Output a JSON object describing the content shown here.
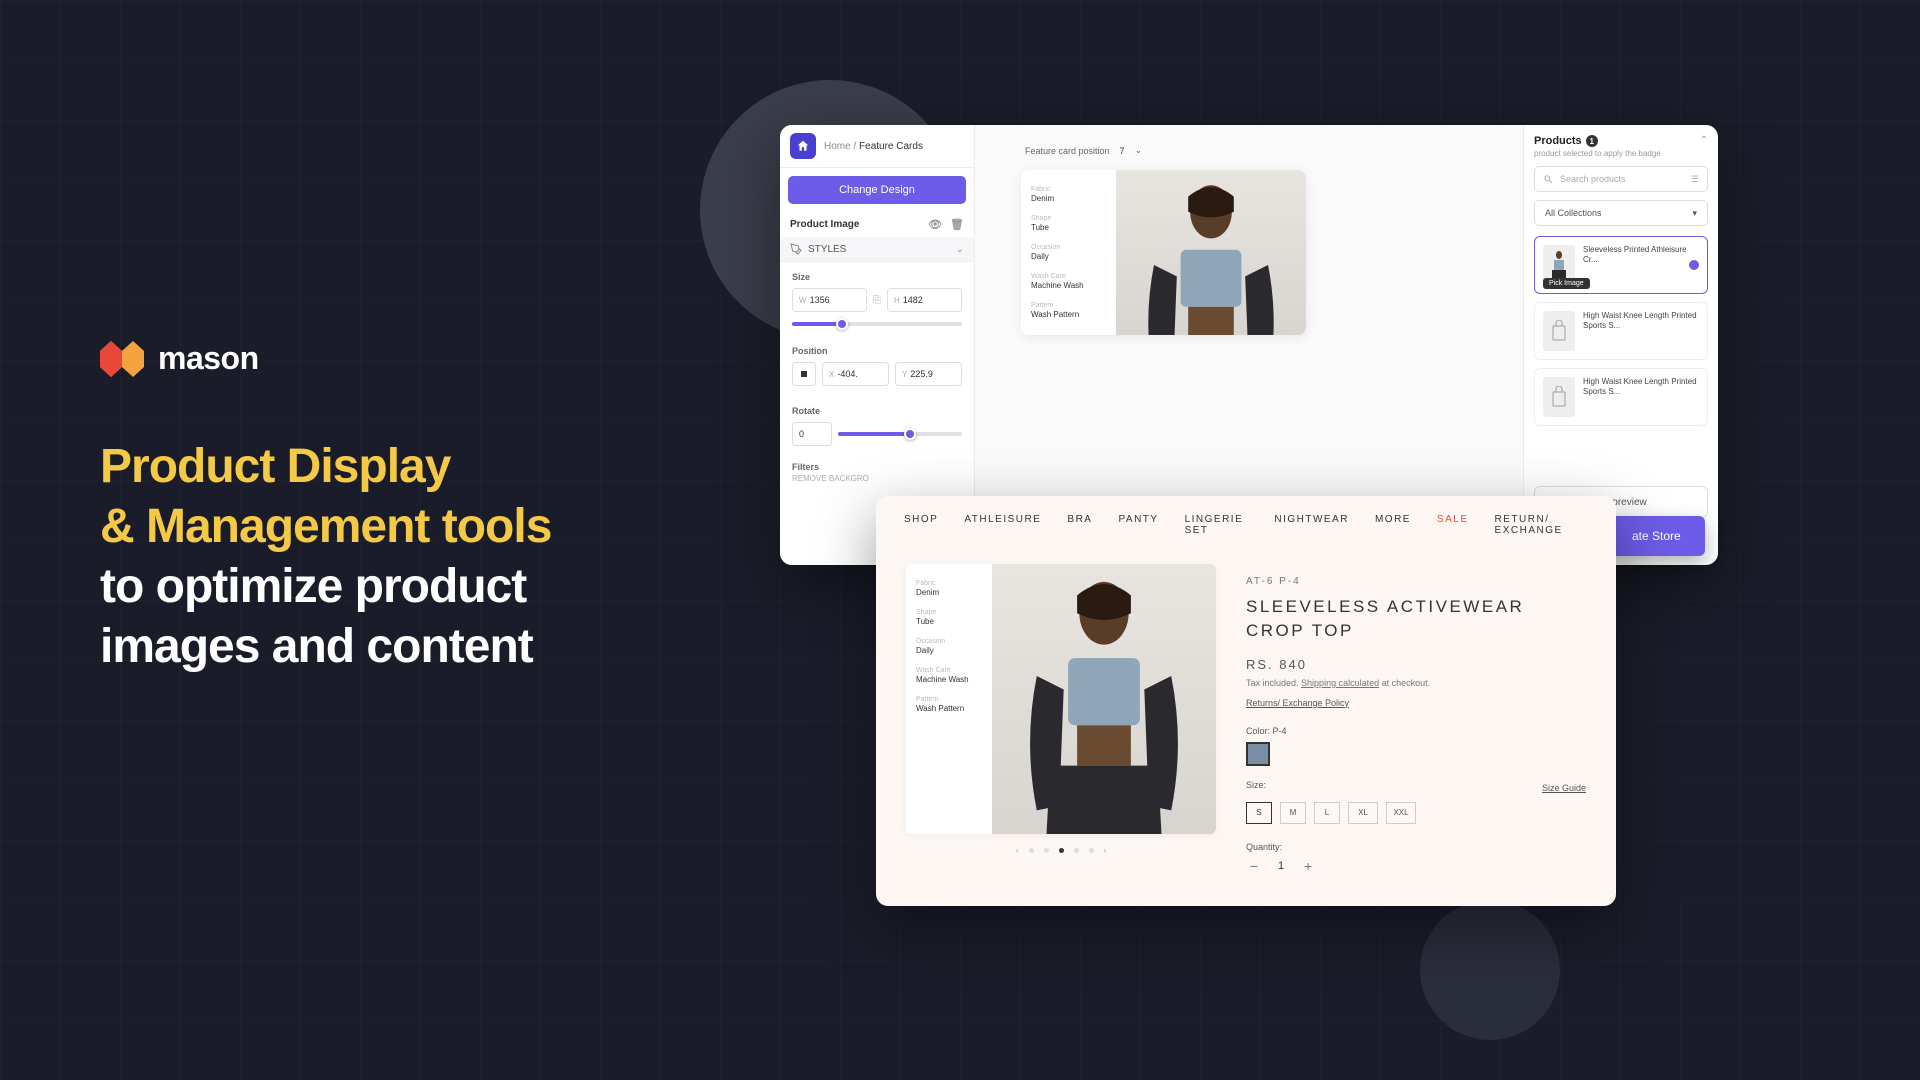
{
  "brand": {
    "name": "mason"
  },
  "headline": {
    "line1": "Product Display",
    "line2": "& Management tools",
    "line3": "to optimize product",
    "line4": "images and content"
  },
  "app1": {
    "breadcrumb": {
      "home": "Home",
      "sep": "/",
      "current": "Feature Cards"
    },
    "change_design": "Change Design",
    "section_title": "Product Image",
    "styles_label": "STYLES",
    "size": {
      "label": "Size",
      "w": "1356",
      "h": "1482"
    },
    "position": {
      "label": "Position",
      "x": "-404.",
      "y": "225.9"
    },
    "rotate": {
      "label": "Rotate",
      "val": "0"
    },
    "filters": {
      "label": "Filters",
      "sub": "REMOVE BACKGRO"
    },
    "canvas": {
      "fcp_label": "Feature card position",
      "fcp_val": "7"
    },
    "attrs": [
      {
        "label": "Fabric",
        "value": "Denim"
      },
      {
        "label": "Shape",
        "value": "Tube"
      },
      {
        "label": "Occasion",
        "value": "Daily"
      },
      {
        "label": "Wash Care",
        "value": "Machine Wash"
      },
      {
        "label": "Pattern",
        "value": "Wash Pattern"
      }
    ],
    "right": {
      "title": "Products",
      "badge": "1",
      "sub": "product selected to apply the badge",
      "search_placeholder": "Search products",
      "collections": "All Collections",
      "products": [
        {
          "name": "Sleeveless Printed Athleisure Cr...",
          "selected": true,
          "pick": "Pick Image"
        },
        {
          "name": "High Waist Knee Length Printed Sports S...",
          "selected": false
        },
        {
          "name": "High Waist Knee Length Printed Sports S...",
          "selected": false
        }
      ],
      "preview": "preview",
      "create": "ate Store"
    }
  },
  "app2": {
    "nav": [
      "SHOP",
      "ATHLEISURE",
      "BRA",
      "PANTY",
      "LINGERIE SET",
      "NIGHTWEAR",
      "MORE",
      "SALE",
      "RETURN/ EXCHANGE"
    ],
    "attrs": [
      {
        "label": "Fabric",
        "value": "Denim"
      },
      {
        "label": "Shape",
        "value": "Tube"
      },
      {
        "label": "Occasion",
        "value": "Daily"
      },
      {
        "label": "Wash Care",
        "value": "Machine Wash"
      },
      {
        "label": "Pattern",
        "value": "Wash Pattern"
      }
    ],
    "sku": "AT-6 P-4",
    "title": "SLEEVELESS ACTIVEWEAR CROP TOP",
    "price": "RS. 840",
    "tax_pre": "Tax included. ",
    "tax_link": "Shipping calculated",
    "tax_post": " at checkout.",
    "policy": "Returns/ Exchange Policy",
    "color_label": "Color: P-4",
    "size_label": "Size:",
    "size_guide": "Size Guide",
    "sizes": [
      "S",
      "M",
      "L",
      "XL",
      "XXL"
    ],
    "qty_label": "Quantity:",
    "qty_val": "1"
  }
}
